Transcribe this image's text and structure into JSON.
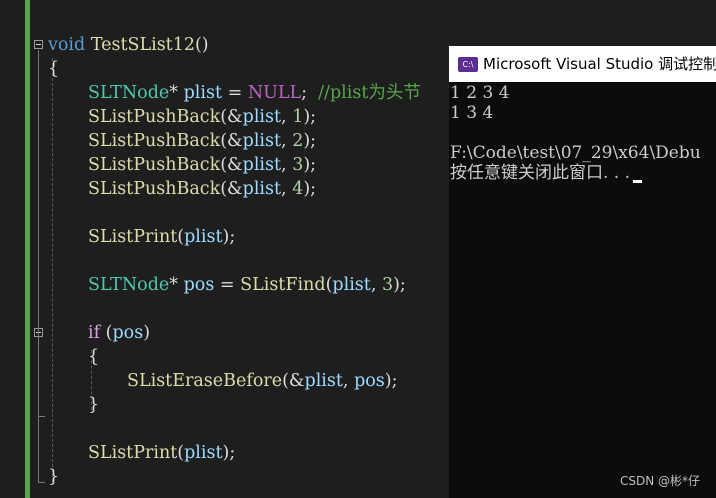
{
  "colors": {
    "editor_bg": "#1e1e1e",
    "change_bar": "#57a64a",
    "keyword": "#569cd6",
    "control_keyword": "#d8a0df",
    "type": "#4ec9b0",
    "function": "#dcdcaa",
    "variable": "#9cdcfe",
    "number": "#b5cea8",
    "macro": "#bd63c5",
    "comment": "#57a64a",
    "console_bg": "#0c0c0c",
    "console_text": "#cccccc"
  },
  "editor": {
    "lines": [
      [
        {
          "t": "void",
          "c": "kw"
        },
        {
          "t": " ",
          "c": "plain"
        },
        {
          "t": "TestSList12",
          "c": "fn"
        },
        {
          "t": "()",
          "c": "plain"
        }
      ],
      [
        {
          "t": "{",
          "c": "plain"
        }
      ],
      [
        {
          "t": "SLTNode",
          "c": "type"
        },
        {
          "t": "* ",
          "c": "plain"
        },
        {
          "t": "plist",
          "c": "var"
        },
        {
          "t": " = ",
          "c": "plain"
        },
        {
          "t": "NULL",
          "c": "mac"
        },
        {
          "t": ";  ",
          "c": "plain"
        },
        {
          "t": "//plist为头节",
          "c": "cmt"
        }
      ],
      [
        {
          "t": "SListPushBack",
          "c": "fn"
        },
        {
          "t": "(&",
          "c": "plain"
        },
        {
          "t": "plist",
          "c": "var"
        },
        {
          "t": ", ",
          "c": "plain"
        },
        {
          "t": "1",
          "c": "num"
        },
        {
          "t": ");",
          "c": "plain"
        }
      ],
      [
        {
          "t": "SListPushBack",
          "c": "fn"
        },
        {
          "t": "(&",
          "c": "plain"
        },
        {
          "t": "plist",
          "c": "var"
        },
        {
          "t": ", ",
          "c": "plain"
        },
        {
          "t": "2",
          "c": "num"
        },
        {
          "t": ");",
          "c": "plain"
        }
      ],
      [
        {
          "t": "SListPushBack",
          "c": "fn"
        },
        {
          "t": "(&",
          "c": "plain"
        },
        {
          "t": "plist",
          "c": "var"
        },
        {
          "t": ", ",
          "c": "plain"
        },
        {
          "t": "3",
          "c": "num"
        },
        {
          "t": ");",
          "c": "plain"
        }
      ],
      [
        {
          "t": "SListPushBack",
          "c": "fn"
        },
        {
          "t": "(&",
          "c": "plain"
        },
        {
          "t": "plist",
          "c": "var"
        },
        {
          "t": ", ",
          "c": "plain"
        },
        {
          "t": "4",
          "c": "num"
        },
        {
          "t": ");",
          "c": "plain"
        }
      ],
      [],
      [
        {
          "t": "SListPrint",
          "c": "fn"
        },
        {
          "t": "(",
          "c": "plain"
        },
        {
          "t": "plist",
          "c": "var"
        },
        {
          "t": ");",
          "c": "plain"
        }
      ],
      [],
      [
        {
          "t": "SLTNode",
          "c": "type"
        },
        {
          "t": "* ",
          "c": "plain"
        },
        {
          "t": "pos",
          "c": "var"
        },
        {
          "t": " = ",
          "c": "plain"
        },
        {
          "t": "SListFind",
          "c": "fn"
        },
        {
          "t": "(",
          "c": "plain"
        },
        {
          "t": "plist",
          "c": "var"
        },
        {
          "t": ", ",
          "c": "plain"
        },
        {
          "t": "3",
          "c": "num"
        },
        {
          "t": ");",
          "c": "plain"
        }
      ],
      [],
      [
        {
          "t": "if",
          "c": "kwc"
        },
        {
          "t": " (",
          "c": "plain"
        },
        {
          "t": "pos",
          "c": "var"
        },
        {
          "t": ")",
          "c": "plain"
        }
      ],
      [
        {
          "t": "{",
          "c": "plain"
        }
      ],
      [
        {
          "t": "SListEraseBefore",
          "c": "fn"
        },
        {
          "t": "(&",
          "c": "plain"
        },
        {
          "t": "plist",
          "c": "var"
        },
        {
          "t": ", ",
          "c": "plain"
        },
        {
          "t": "pos",
          "c": "var"
        },
        {
          "t": ");",
          "c": "plain"
        }
      ],
      [
        {
          "t": "}",
          "c": "plain"
        }
      ],
      [],
      [
        {
          "t": "SListPrint",
          "c": "fn"
        },
        {
          "t": "(",
          "c": "plain"
        },
        {
          "t": "plist",
          "c": "var"
        },
        {
          "t": ");",
          "c": "plain"
        }
      ],
      [
        {
          "t": "}",
          "c": "plain"
        }
      ]
    ]
  },
  "console": {
    "title": "Microsoft Visual Studio 调试控制",
    "icon_label": "C:\\",
    "output_lines": [
      "1 2 3 4",
      "1 3 4",
      "",
      "F:\\Code\\test\\07_29\\x64\\Debu",
      "按任意键关闭此窗口. . ."
    ]
  },
  "watermark": "CSDN @彬*仔"
}
